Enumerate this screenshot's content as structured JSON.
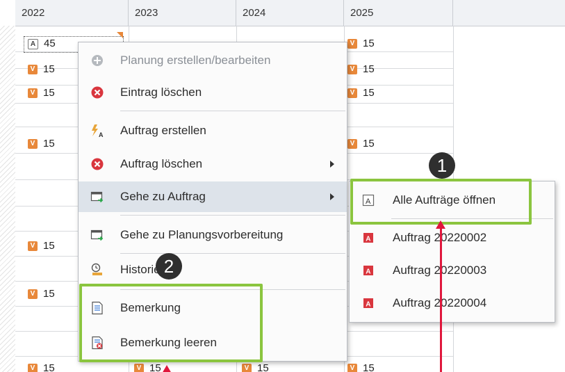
{
  "grid": {
    "years": [
      "2022",
      "2023",
      "2024",
      "2025"
    ],
    "cells": [
      {
        "type": "A",
        "text": "45"
      },
      {
        "type": "V",
        "text": "15"
      },
      {
        "type": "V",
        "text": "15"
      },
      {
        "type": "V",
        "text": "15"
      },
      {
        "type": "V",
        "text": "15"
      },
      {
        "type": "V",
        "text": "15"
      },
      {
        "type": "V",
        "text": "15"
      },
      {
        "type": "V",
        "text": "15"
      },
      {
        "type": "V",
        "text": "15"
      },
      {
        "type": "V",
        "text": "15"
      },
      {
        "type": "V",
        "text": "15"
      },
      {
        "type": "V",
        "text": "15"
      },
      {
        "type": "V",
        "text": "15"
      },
      {
        "type": "V",
        "text": "15"
      },
      {
        "type": "V",
        "text": "15"
      }
    ],
    "badge_A": "A",
    "badge_V": "V"
  },
  "context_menu": {
    "items": [
      {
        "label": "Planung erstellen/bearbeiten",
        "icon": "plus-circle-icon",
        "disabled": true
      },
      {
        "label": "Eintrag löschen",
        "icon": "delete-red-icon"
      },
      {
        "label": "Auftrag erstellen",
        "icon": "lightning-a-icon"
      },
      {
        "label": "Auftrag löschen",
        "icon": "delete-red-icon",
        "submenu": true
      },
      {
        "label": "Gehe zu Auftrag",
        "icon": "goto-window-icon",
        "submenu": true,
        "highlighted": true
      },
      {
        "label": "Gehe zu Planungsvorbereitung",
        "icon": "goto-window-icon"
      },
      {
        "label": "Historie",
        "icon": "history-icon"
      },
      {
        "label": "Bemerkung",
        "icon": "note-icon"
      },
      {
        "label": "Bemerkung leeren",
        "icon": "note-clear-icon"
      }
    ]
  },
  "submenu": {
    "items": [
      {
        "label": "Alle Aufträge öffnen",
        "icon": "order-box-icon"
      },
      {
        "label": "Auftrag 20220002",
        "icon": "order-red-icon"
      },
      {
        "label": "Auftrag 20220003",
        "icon": "order-red-icon"
      },
      {
        "label": "Auftrag 20220004",
        "icon": "order-red-icon"
      }
    ]
  },
  "callouts": {
    "one": "1",
    "two": "2"
  },
  "colors": {
    "highlight_green": "#8bc53f",
    "badge_orange": "#e8883a",
    "arrow_red": "#e0173c",
    "callout_bg": "#2f2f2f"
  }
}
